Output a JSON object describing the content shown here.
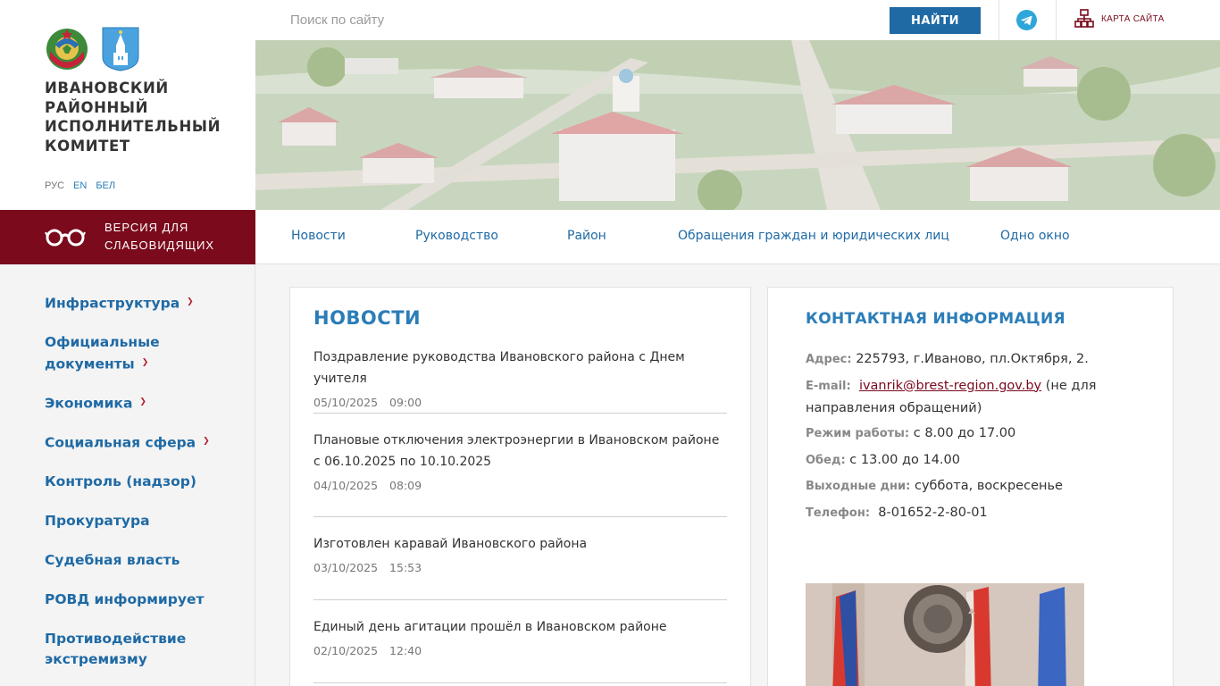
{
  "org": {
    "name": "ИВАНОВСКИЙ РАЙОННЫЙ ИСПОЛНИТЕЛЬНЫЙ КОМИТЕТ",
    "languages": [
      "РУС",
      "EN",
      "БЕЛ"
    ]
  },
  "accessibility": {
    "label": "ВЕРСИЯ ДЛЯ СЛАБОВИДЯЩИХ"
  },
  "sidebar": {
    "items": [
      {
        "label": "Инфраструктура",
        "has_submenu": true
      },
      {
        "label": "Официальные документы",
        "has_submenu": true
      },
      {
        "label": "Экономика",
        "has_submenu": true
      },
      {
        "label": "Социальная сфера",
        "has_submenu": true
      },
      {
        "label": "Контроль (надзор)",
        "has_submenu": false
      },
      {
        "label": "Прокуратура",
        "has_submenu": false
      },
      {
        "label": "Судебная власть",
        "has_submenu": false
      },
      {
        "label": "РОВД информирует",
        "has_submenu": false
      },
      {
        "label": "Противодействие экстремизму",
        "has_submenu": false
      }
    ]
  },
  "search": {
    "placeholder": "Поиск по сайту",
    "button_label": "НАЙТИ"
  },
  "header": {
    "sitemap_label": "КАРТА САЙТА",
    "telegram_icon": "telegram-icon"
  },
  "main_nav": {
    "items": [
      "Новости",
      "Руководство",
      "Район",
      "Обращения граждан и юридических лиц",
      "Одно окно"
    ]
  },
  "news": {
    "title": "НОВОСТИ",
    "items": [
      {
        "title": "Поздравление руководства Ивановского района с Днем учителя",
        "date": "05/10/2025",
        "time": "09:00"
      },
      {
        "title": "Плановые отключения электроэнергии в Ивановском районе с 06.10.2025 по 10.10.2025",
        "date": "04/10/2025",
        "time": "08:09"
      },
      {
        "title": "Изготовлен каравай Ивановского района",
        "date": "03/10/2025",
        "time": "15:53"
      },
      {
        "title": "Единый день агитации прошёл в Ивановском районе",
        "date": "02/10/2025",
        "time": "12:40"
      }
    ]
  },
  "contacts": {
    "title": "КОНТАКТНАЯ ИНФОРМАЦИЯ",
    "address_label": "Адрес:",
    "address": "225793, г.Иваново, пл.Октября, 2.",
    "email_label": "E-mail:",
    "email": "ivanrik@brest-region.gov.by",
    "email_note": "(не для направления обращений)",
    "hours_label": "Режим работы:",
    "hours": "с 8.00 до 17.00",
    "lunch_label": "Обед:",
    "lunch": "с 13.00 до 14.00",
    "days_off_label": "Выходные дни:",
    "days_off": "суббота, воскресенье",
    "phone_label": "Телефон:",
    "phone": "8-01652-2-80-01"
  },
  "colors": {
    "accent_blue": "#1f6aa5",
    "burgundy": "#7a0a1c"
  }
}
